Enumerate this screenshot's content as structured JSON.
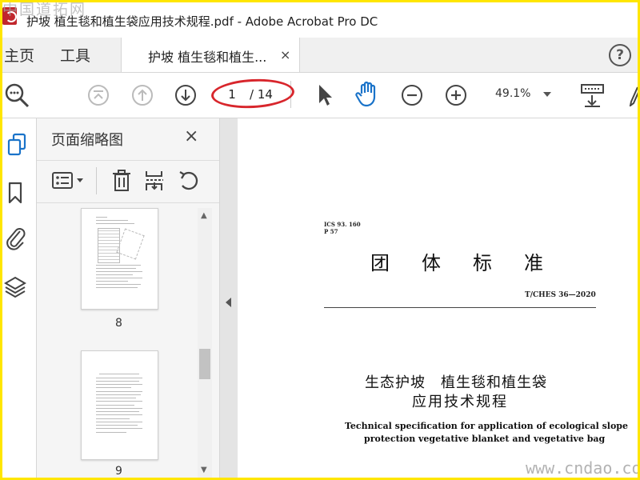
{
  "window": {
    "title": "护坡 植生毯和植生袋应用技术规程.pdf - Adobe Acrobat Pro DC",
    "watermark_top": "中国道拓网",
    "watermark_bottom": "www.cndao.com"
  },
  "tabs": {
    "home": "主页",
    "tools": "工具",
    "document": "护坡 植生毯和植生...",
    "close": "×",
    "help": "?"
  },
  "toolbar": {
    "current_page": "1",
    "total_pages": "/ 14",
    "zoom": "49.1%"
  },
  "thumbnail_panel": {
    "title": "页面缩略图",
    "close": "×",
    "pages": [
      "8",
      "9"
    ]
  },
  "document": {
    "ics": "ICS 93. 160",
    "classification": "P 57",
    "heading": "团体标准",
    "standard_code": "T/CHES 36—2020",
    "zh_title_line1": "生态护坡　植生毯和植生袋",
    "zh_title_line2": "应用技术规程",
    "en_title_line1": "Technical specification for application of ecological slope",
    "en_title_line2": "protection vegetative blanket and vegetative bag"
  }
}
